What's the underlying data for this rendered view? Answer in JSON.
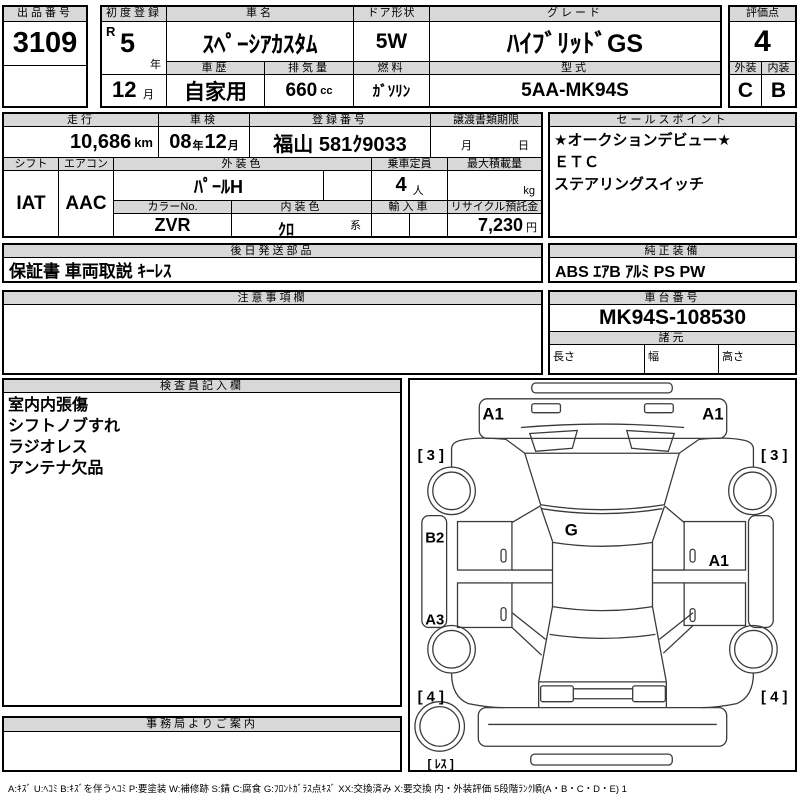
{
  "colors": {
    "header_bg": "#d8d8d8",
    "line": "#000000"
  },
  "top": {
    "lot": {
      "label": "出品番号",
      "value": "3109"
    },
    "first_reg": {
      "label": "初度登録",
      "era": "R",
      "year": "5",
      "year_unit": "年",
      "month": "12",
      "month_unit": "月"
    },
    "car_name": {
      "label": "車名",
      "value": "ｽﾍﾟｰｼｱｶｽﾀﾑ"
    },
    "history": {
      "label": "車歴",
      "value": "自家用"
    },
    "displacement": {
      "label": "排気量",
      "value": "660",
      "unit": "cc"
    },
    "door": {
      "label": "ドア形状",
      "value": "5W"
    },
    "fuel": {
      "label": "燃料",
      "value": "ｶﾞｿﾘﾝ"
    },
    "grade": {
      "label": "グレード",
      "value": "ﾊｲﾌﾞﾘｯﾄﾞGS"
    },
    "model": {
      "label": "型式",
      "value": "5AA-MK94S"
    },
    "score": {
      "label": "評価点",
      "value": "4"
    },
    "exterior": {
      "label": "外装",
      "value": "C"
    },
    "interior": {
      "label": "内装",
      "value": "B"
    }
  },
  "middle": {
    "mileage": {
      "label": "走行",
      "value": "10,686",
      "unit": "km"
    },
    "inspection": {
      "label": "車検",
      "year": "08",
      "year_unit": "年",
      "month": "12",
      "month_unit": "月"
    },
    "reg_no": {
      "label": "登録番号",
      "value": "福山 581ｸ9033"
    },
    "transfer": {
      "label": "譲渡書類期限",
      "month_label": "月",
      "day_label": "日"
    },
    "shift": {
      "label": "シフト",
      "value": "IAT"
    },
    "aircon": {
      "label": "エアコン",
      "value": "AAC"
    },
    "ext_color": {
      "label": "外装色",
      "value": "ﾊﾟｰﾙH"
    },
    "capacity": {
      "label": "乗車定員",
      "value": "4",
      "unit": "人"
    },
    "max_load": {
      "label": "最大積載量",
      "unit": "kg"
    },
    "color_no": {
      "label": "カラーNo.",
      "value": "ZVR"
    },
    "int_color": {
      "label": "内装色",
      "value": "ｸﾛ",
      "suffix": "系"
    },
    "import": {
      "label": "輸入車"
    },
    "recycle": {
      "label": "リサイクル預託金",
      "value": "7,230",
      "unit": "円"
    }
  },
  "sales": {
    "label": "セールスポイント",
    "lines": [
      "★オークションデビュー★",
      "ＥＴＣ",
      "ステアリングスイッチ"
    ]
  },
  "later_parts": {
    "label": "後日発送部品",
    "value": "保証書 車両取説 ｷｰﾚｽ"
  },
  "oem": {
    "label": "純正装備",
    "value": "ABS ｴｱB ｱﾙﾐ PS PW"
  },
  "notes": {
    "label": "注意事項欄",
    "value": ""
  },
  "chassis": {
    "label": "車台番号",
    "value": "MK94S-108530"
  },
  "specs": {
    "label": "諸元",
    "length_label": "長さ",
    "width_label": "幅",
    "height_label": "高さ"
  },
  "inspector": {
    "label": "検査員記入欄",
    "lines": [
      "室内内張傷",
      "シフトノブすれ",
      "ラジオレス",
      "アンテナ欠品"
    ]
  },
  "office": {
    "label": "事務局よりご案内",
    "value": ""
  },
  "diagram": {
    "marks": {
      "hood_left": "A1",
      "hood_right": "A1",
      "front_tire_left": "[ 3 ]",
      "front_tire_right": "[ 3 ]",
      "side_top": "B2",
      "side_bottom": "A3",
      "glass": "G",
      "door_right": "A1",
      "rear_tire_left": "[ 4 ]",
      "rear_tire_right": "[ 4 ]",
      "spare": "[ ﾚｽ ]"
    }
  },
  "legend": "A:ｷｽﾞ U:ﾍｺﾐ B:ｷｽﾞを伴うﾍｺﾐ P:要塗装 W:補修跡 S:錆 C:腐食 G:ﾌﾛﾝﾄｶﾞﾗｽ点ｷｽﾞ XX:交換済み X:要交換  内・外装評価  5段階ﾗﾝｸ順(A・B・C・D・E) 1"
}
